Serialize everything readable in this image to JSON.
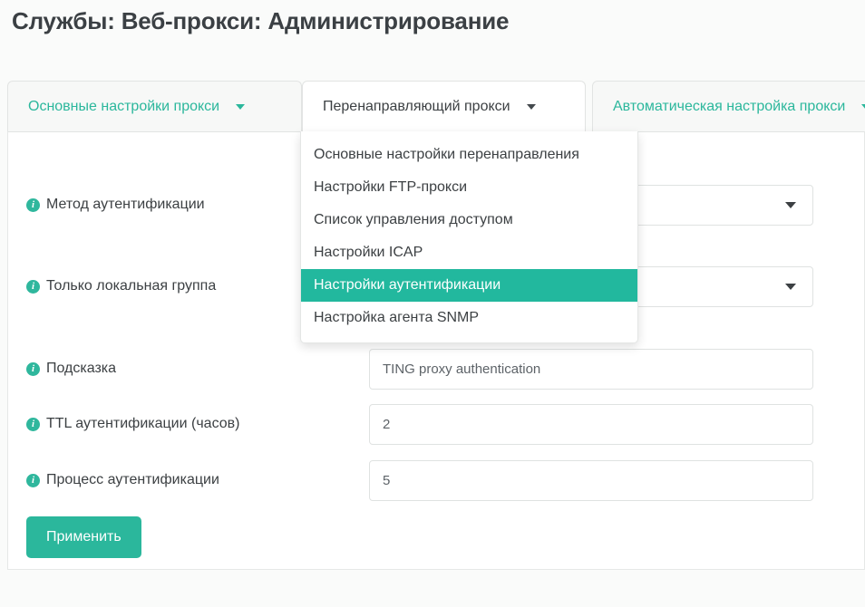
{
  "page": {
    "title": "Службы: Веб-прокси: Администрирование",
    "background_color": "#fafbfa",
    "accent_color": "#2bb79c"
  },
  "tabs": [
    {
      "label": "Основные настройки прокси",
      "caret": "chevron-down-icon",
      "active": false
    },
    {
      "label": "Перенаправляющий прокси",
      "caret": "chevron-down-icon",
      "active": true
    },
    {
      "label": "Автоматическая настройка прокси",
      "caret": "chevron-down-icon",
      "active": false
    }
  ],
  "dropdown": {
    "open": true,
    "owner_tab": "Перенаправляющий прокси",
    "items": [
      {
        "label": "Основные настройки перенаправления",
        "selected": false
      },
      {
        "label": "Настройки FTP-прокси",
        "selected": false
      },
      {
        "label": "Список управления доступом",
        "selected": false
      },
      {
        "label": "Настройки ICAP",
        "selected": false
      },
      {
        "label": "Настройки аутентификации",
        "selected": true
      },
      {
        "label": "Настройка агента SNMP",
        "selected": false
      }
    ],
    "selected_color": "#22b89e"
  },
  "form": {
    "fields": [
      {
        "label": "Метод аутентификации",
        "icon": "info-icon",
        "control": "select",
        "value": ""
      },
      {
        "label": "Только локальная группа",
        "icon": "info-icon",
        "control": "select",
        "value": ""
      },
      {
        "label": "Подсказка",
        "icon": "info-icon",
        "control": "text",
        "value": "TING proxy authentication"
      },
      {
        "label": "TTL аутентификации (часов)",
        "icon": "info-icon",
        "control": "text",
        "value": "2"
      },
      {
        "label": "Процесс аутентификации",
        "icon": "info-icon",
        "control": "text",
        "value": "5"
      }
    ],
    "info_glyph": "i"
  },
  "actions": {
    "apply_label": "Применить"
  }
}
